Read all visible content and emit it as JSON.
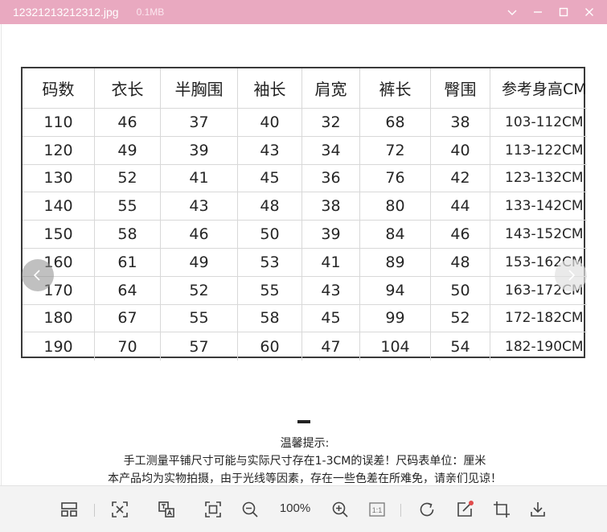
{
  "window": {
    "file_name": "12321213212312.jpg",
    "file_size": "0.1MB"
  },
  "size_chart": {
    "headers": [
      "码数",
      "衣长",
      "半胸围",
      "袖长",
      "肩宽",
      "裤长",
      "臀围",
      "参考身高CM"
    ],
    "rows": [
      [
        "110",
        "46",
        "37",
        "40",
        "32",
        "68",
        "38",
        "103-112CM"
      ],
      [
        "120",
        "49",
        "39",
        "43",
        "34",
        "72",
        "40",
        "113-122CM"
      ],
      [
        "130",
        "52",
        "41",
        "45",
        "36",
        "76",
        "42",
        "123-132CM"
      ],
      [
        "140",
        "55",
        "43",
        "48",
        "38",
        "80",
        "44",
        "133-142CM"
      ],
      [
        "150",
        "58",
        "46",
        "50",
        "39",
        "84",
        "46",
        "143-152CM"
      ],
      [
        "160",
        "61",
        "49",
        "53",
        "41",
        "89",
        "48",
        "153-162CM"
      ],
      [
        "170",
        "64",
        "52",
        "55",
        "43",
        "94",
        "50",
        "163-172CM"
      ],
      [
        "180",
        "67",
        "55",
        "58",
        "45",
        "99",
        "52",
        "172-182CM"
      ],
      [
        "190",
        "70",
        "57",
        "60",
        "47",
        "104",
        "54",
        "182-190CM"
      ]
    ]
  },
  "notice": {
    "title": "温馨提示:",
    "line1": "手工测量平铺尺寸可能与实际尺寸存在1-3CM的误差！尺码表单位：厘米",
    "line2": "本产品均为实物拍摄，由于光线等因素，存在一些色差在所难免，请亲们见谅！"
  },
  "toolbar": {
    "zoom_level": "100%",
    "icons": [
      "thumbnails-icon",
      "fit-window-icon",
      "ocr-icon",
      "fullscreen-icon",
      "zoom-out-icon",
      "zoom-in-icon",
      "actual-size-icon",
      "rotate-icon",
      "edit-icon",
      "crop-icon",
      "download-icon"
    ],
    "actual_size_label": "1:1",
    "edit_badge_color": "#e04b4b"
  },
  "colors": {
    "titlebar": "#e9a9c0",
    "toolbar": "#f3f3f3"
  }
}
